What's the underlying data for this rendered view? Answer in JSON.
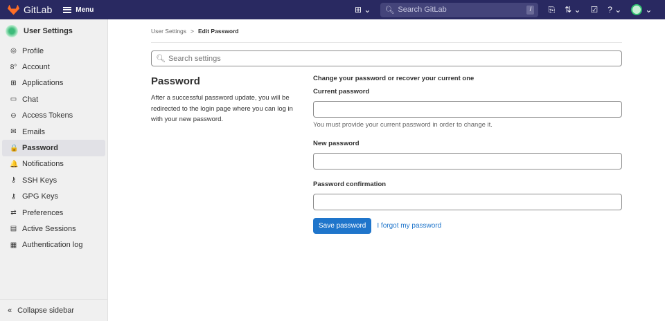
{
  "header": {
    "brand": "GitLab",
    "menu": "Menu",
    "search_placeholder": "Search GitLab",
    "shortcut": "/"
  },
  "sidebar": {
    "title": "User Settings",
    "items": [
      {
        "label": "Profile",
        "icon": "◎"
      },
      {
        "label": "Account",
        "icon": "8°"
      },
      {
        "label": "Applications",
        "icon": "⊞"
      },
      {
        "label": "Chat",
        "icon": "▭"
      },
      {
        "label": "Access Tokens",
        "icon": "⊖"
      },
      {
        "label": "Emails",
        "icon": "✉"
      },
      {
        "label": "Password",
        "icon": "🔒"
      },
      {
        "label": "Notifications",
        "icon": "🔔"
      },
      {
        "label": "SSH Keys",
        "icon": "⚷"
      },
      {
        "label": "GPG Keys",
        "icon": "⚷"
      },
      {
        "label": "Preferences",
        "icon": "⇄"
      },
      {
        "label": "Active Sessions",
        "icon": "▤"
      },
      {
        "label": "Authentication log",
        "icon": "▦"
      }
    ],
    "collapse": "Collapse sidebar"
  },
  "breadcrumb": {
    "parent": "User Settings",
    "sep": ">",
    "current": "Edit Password"
  },
  "search_settings": "Search settings",
  "section": {
    "title": "Password",
    "description": "After a successful password update, you will be redirected to the login page where you can log in with your new password."
  },
  "form": {
    "heading": "Change your password or recover your current one",
    "current_label": "Current password",
    "current_help": "You must provide your current password in order to change it.",
    "new_label": "New password",
    "confirm_label": "Password confirmation",
    "save": "Save password",
    "forgot": "I forgot my password"
  }
}
